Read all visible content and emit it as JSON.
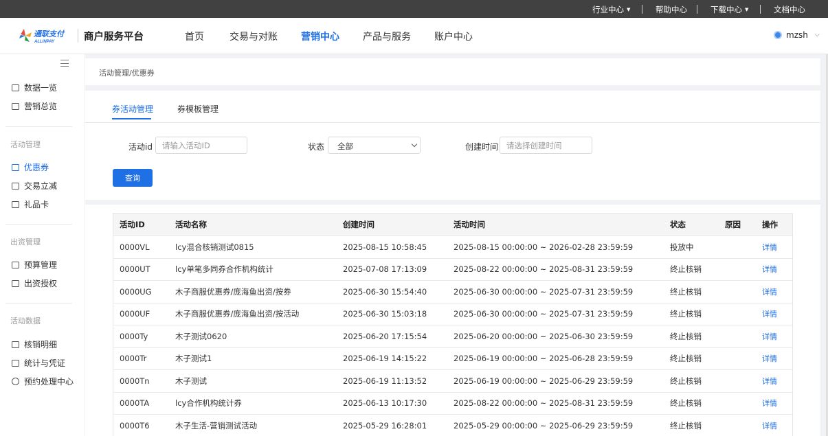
{
  "topbar": {
    "industry": "行业中心",
    "help": "帮助中心",
    "download": "下载中心",
    "docs": "文档中心"
  },
  "header": {
    "logo_cn": "通联支付",
    "logo_en": "ALLINPAY",
    "platform": "商户服务平台",
    "nav": [
      "首页",
      "交易与对账",
      "营销中心",
      "产品与服务",
      "账户中心"
    ],
    "active_nav": "营销中心",
    "user": "mzsh"
  },
  "sidebar": {
    "items_top": [
      "数据一览",
      "营销总览"
    ],
    "group1": "活动管理",
    "items_group1": [
      "优惠券",
      "交易立减",
      "礼品卡"
    ],
    "active_item": "优惠券",
    "group2": "出资管理",
    "items_group2": [
      "预算管理",
      "出资授权"
    ],
    "group3": "活动数据",
    "items_group3": [
      "核销明细",
      "统计与凭证",
      "预约处理中心"
    ]
  },
  "breadcrumb": "活动管理/优惠券",
  "tabs": [
    "券活动管理",
    "券模板管理"
  ],
  "filter": {
    "id_label": "活动id",
    "id_placeholder": "请输入活动ID",
    "status_label": "状态",
    "status_value": "全部",
    "time_label": "创建时间",
    "time_placeholder": "请选择创建时间",
    "query": "查询"
  },
  "table": {
    "headers": [
      "活动ID",
      "活动名称",
      "创建时间",
      "活动时间",
      "状态",
      "原因",
      "操作"
    ],
    "rows": [
      {
        "id": "0000VL",
        "name": "lcy混合核销测试0815",
        "created": "2025-08-15 10:58:45",
        "period": "2025-08-15 00:00:00 ~ 2026-02-28 23:59:59",
        "status": "投放中",
        "reason": "",
        "action": "详情"
      },
      {
        "id": "0000UT",
        "name": "lcy单笔多同券合作机构统计",
        "created": "2025-07-08 17:13:09",
        "period": "2025-08-22 00:00:00 ~ 2025-08-31 23:59:59",
        "status": "终止核销",
        "reason": "",
        "action": "详情"
      },
      {
        "id": "0000UG",
        "name": "木子商服优惠券/庞海鱼出资/按券",
        "created": "2025-06-30 15:54:40",
        "period": "2025-06-30 00:00:00 ~ 2025-07-31 23:59:59",
        "status": "终止核销",
        "reason": "",
        "action": "详情"
      },
      {
        "id": "0000UF",
        "name": "木子商服优惠券/庞海鱼出资/按活动",
        "created": "2025-06-30 15:03:18",
        "period": "2025-06-30 00:00:00 ~ 2025-07-31 23:59:59",
        "status": "终止核销",
        "reason": "",
        "action": "详情"
      },
      {
        "id": "0000Ty",
        "name": "木子测试0620",
        "created": "2025-06-20 17:15:54",
        "period": "2025-06-20 00:00:00 ~ 2025-06-30 23:59:59",
        "status": "终止核销",
        "reason": "",
        "action": "详情"
      },
      {
        "id": "0000Tr",
        "name": "木子测试1",
        "created": "2025-06-19 14:15:22",
        "period": "2025-06-19 00:00:00 ~ 2025-06-28 23:59:59",
        "status": "终止核销",
        "reason": "",
        "action": "详情"
      },
      {
        "id": "0000Tn",
        "name": "木子测试",
        "created": "2025-06-19 11:13:52",
        "period": "2025-06-19 00:00:00 ~ 2025-06-29 23:59:59",
        "status": "终止核销",
        "reason": "",
        "action": "详情"
      },
      {
        "id": "0000TA",
        "name": "lcy合作机构统计券",
        "created": "2025-06-13 10:17:30",
        "period": "2025-08-22 00:00:00 ~ 2025-08-31 23:59:59",
        "status": "终止核销",
        "reason": "",
        "action": "详情"
      },
      {
        "id": "0000T6",
        "name": "木子生活-营销测试活动",
        "created": "2025-05-29 16:28:01",
        "period": "2025-05-29 00:00:00 ~ 2025-06-29 23:59:59",
        "status": "终止核销",
        "reason": "",
        "action": "详情"
      }
    ]
  }
}
